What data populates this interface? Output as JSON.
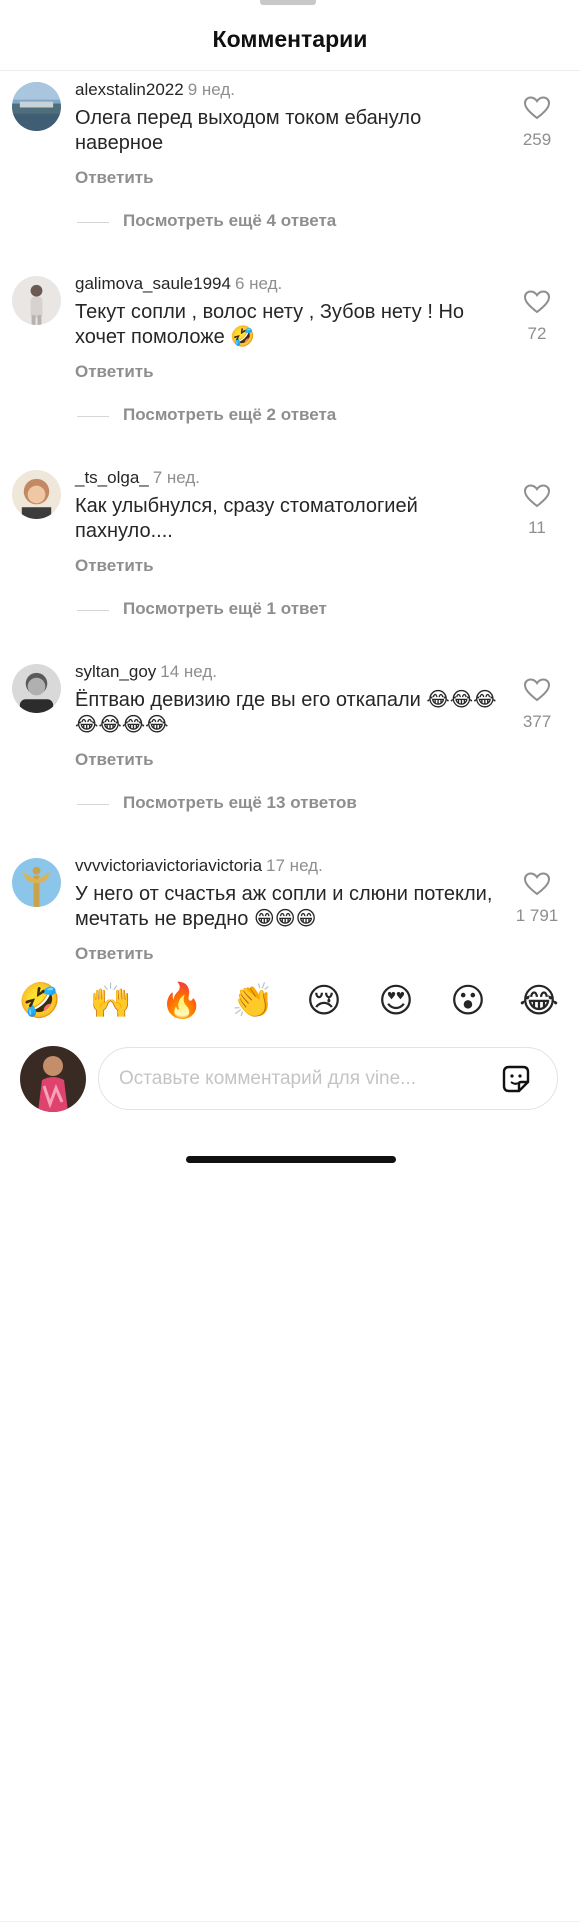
{
  "header": {
    "title": "Комментарии"
  },
  "comments": [
    {
      "username": "alexstalin2022",
      "age": "9 нед.",
      "text": "Олега перед выходом током ебануло наверное",
      "reply_label": "Ответить",
      "more_label": "Посмотреть ещё 4 ответа",
      "likes": "259"
    },
    {
      "username": "galimova_saule1994",
      "age": "6 нед.",
      "text": "Текут сопли , волос нету , Зубов нету ! Но хочет помоложе 🤣",
      "reply_label": "Ответить",
      "more_label": "Посмотреть ещё 2 ответа",
      "likes": "72"
    },
    {
      "username": "_ts_olga_",
      "age": "7 нед.",
      "text": "Как улыбнулся, сразу стоматологией пахнуло....",
      "reply_label": "Ответить",
      "more_label": "Посмотреть ещё 1 ответ",
      "likes": "11"
    },
    {
      "username": "syltan_goy",
      "age": "14 нед.",
      "text": "Ёптваю девизию где вы его откапали 😂😂😂😂😂😂😂",
      "reply_label": "Ответить",
      "more_label": "Посмотреть ещё 13 ответов",
      "likes": "377"
    },
    {
      "username": "vvvvictoriavictoriavictoria",
      "age": "17 нед.",
      "text": "У него от счастья аж сопли и слюни потекли, мечтать не вредно 😁😁😁",
      "reply_label": "Ответить",
      "more_label": "",
      "likes": "1 791"
    }
  ],
  "emoji_bar": [
    "🤣",
    "🙌",
    "🔥",
    "👏",
    "😢",
    "😍",
    "😮",
    "😂"
  ],
  "composer": {
    "placeholder": "Оставьте комментарий для vine..."
  },
  "colors": {
    "text": "#262626",
    "secondary": "#8e8e8e",
    "divider": "#ececec"
  },
  "icons": {
    "like": "heart-outline-icon",
    "sticker": "sticker-icon"
  }
}
